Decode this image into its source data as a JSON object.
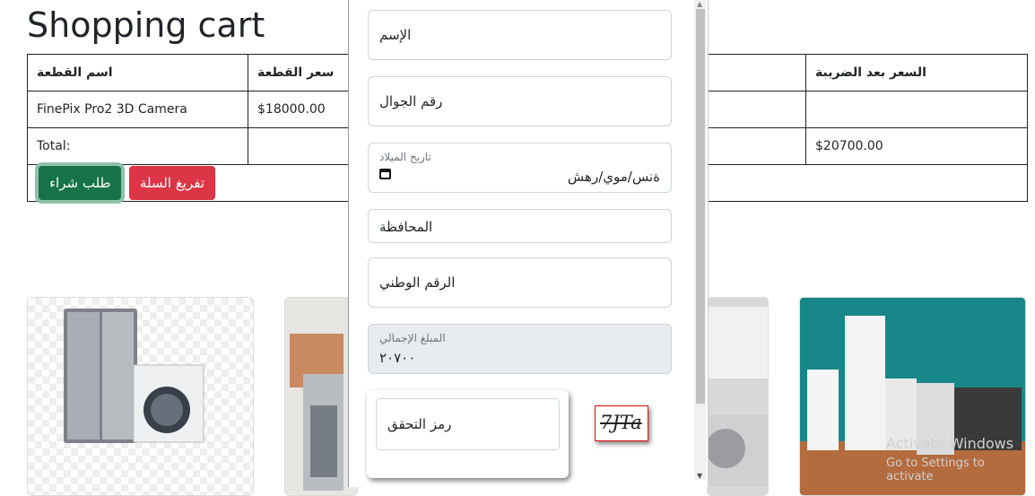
{
  "page": {
    "title": "Shopping cart"
  },
  "cart": {
    "headers": [
      "اسم القطعة",
      "سعر القطعة",
      "السعر بعد الضريبة"
    ],
    "rows": [
      {
        "name": "FinePix Pro2 3D Camera",
        "price": "$18000.00",
        "after_tax": ""
      }
    ],
    "total_label": "Total:",
    "total_value": "$20700.00",
    "order_button": "طلب شراء",
    "empty_button": "تفريغ السلة"
  },
  "form": {
    "name_placeholder": "الإسم",
    "phone_placeholder": "رقم الجوال",
    "birthdate_label": "تاريخ الميلاد",
    "birthdate_value": "ةنس/موي/رهش",
    "governorate_placeholder": "المحافظة",
    "national_id_placeholder": "الرقم الوطني",
    "total_label": "المبلغ الإجمالي",
    "total_value": "٢٠٧٠٠",
    "captcha_placeholder": "رمز التحقق",
    "captcha_code": "7JTa"
  },
  "os": {
    "watermark_title": "Activate Windows",
    "watermark_sub": "Go to Settings to activate"
  },
  "icons": {
    "calendar": "calendar-icon"
  }
}
